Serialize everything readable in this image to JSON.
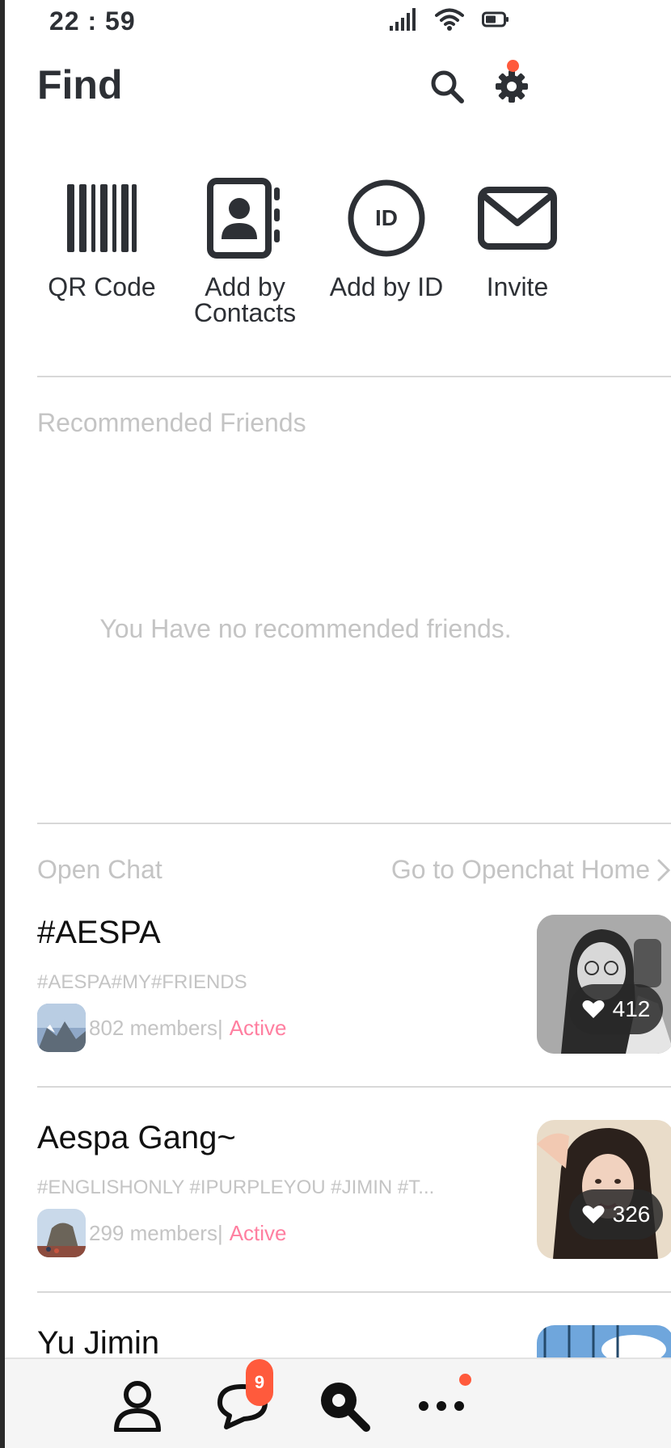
{
  "status": {
    "time": "22 : 59"
  },
  "header": {
    "title": "Find"
  },
  "quick_actions": [
    {
      "label": "QR Code"
    },
    {
      "label": "Add by\nContacts"
    },
    {
      "label": "Add by ID",
      "icon_text": "ID"
    },
    {
      "label": "Invite"
    }
  ],
  "recommended": {
    "title": "Recommended Friends",
    "empty_message": "You Have no recommended friends."
  },
  "open_chat": {
    "title": "Open Chat",
    "link_label": "Go to Openchat Home",
    "items": [
      {
        "name": "#AESPA",
        "tags": "#AESPA#MY#FRIENDS",
        "members": "802 members|",
        "status": "Active",
        "likes": "412"
      },
      {
        "name": "Aespa Gang~",
        "tags": "#ENGLISHONLY #IPURPLEYOU #JIMIN #T...",
        "members": "299 members|",
        "status": "Active",
        "likes": "326"
      },
      {
        "name": "Yu Jimin"
      }
    ]
  },
  "bottom_nav": {
    "chat_badge": "9"
  },
  "colors": {
    "accent_red": "#ff5a3c",
    "active_pink": "#ff7fa0",
    "muted": "#c4c4c4"
  }
}
